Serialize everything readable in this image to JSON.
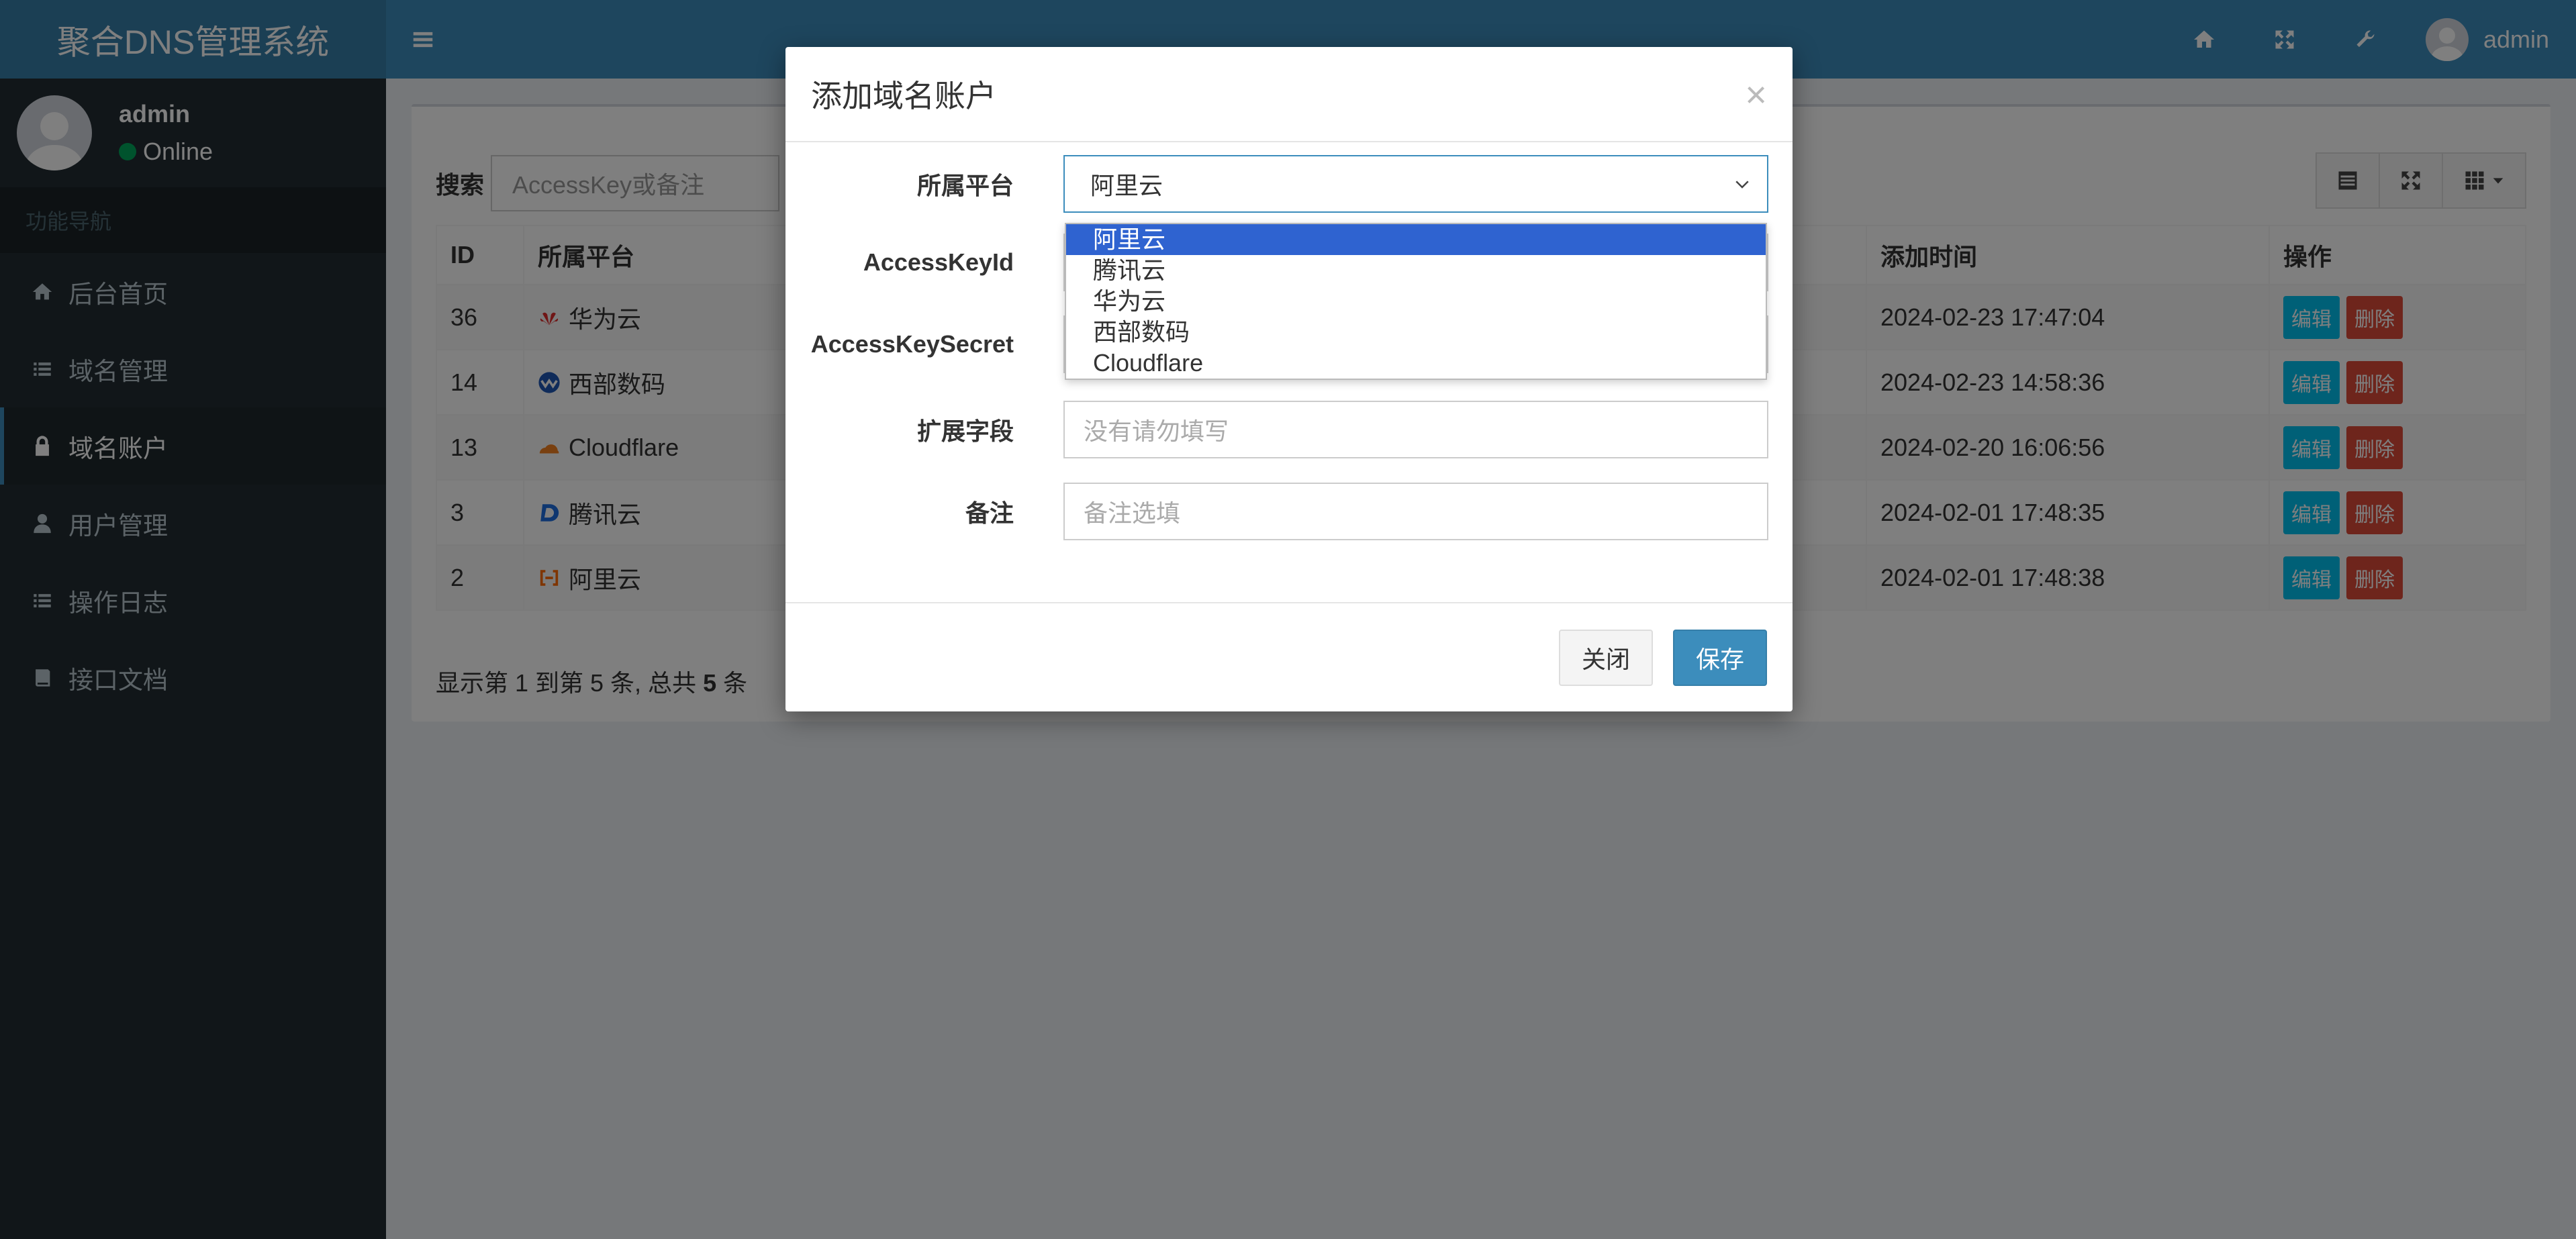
{
  "app": {
    "title": "聚合DNS管理系统"
  },
  "user": {
    "name": "admin",
    "status": "Online"
  },
  "sidebar": {
    "header": "功能导航",
    "items": [
      {
        "label": "后台首页",
        "icon": "home-icon"
      },
      {
        "label": "域名管理",
        "icon": "list-icon"
      },
      {
        "label": "域名账户",
        "icon": "lock-icon",
        "active": true
      },
      {
        "label": "用户管理",
        "icon": "user-icon"
      },
      {
        "label": "操作日志",
        "icon": "list-icon"
      },
      {
        "label": "接口文档",
        "icon": "book-icon"
      }
    ]
  },
  "topbar": {
    "username": "admin"
  },
  "search": {
    "label": "搜索",
    "placeholder": "AccessKey或备注"
  },
  "table": {
    "headers": {
      "id": "ID",
      "platform": "所属平台",
      "added": "添加时间",
      "ops": "操作"
    },
    "edit_label": "编辑",
    "delete_label": "删除",
    "rows": [
      {
        "id": "36",
        "platform": "华为云",
        "icon": "huawei-icon",
        "added": "2024-02-23 17:47:04"
      },
      {
        "id": "14",
        "platform": "西部数码",
        "icon": "west-digital-icon",
        "added": "2024-02-23 14:58:36"
      },
      {
        "id": "13",
        "platform": "Cloudflare",
        "icon": "cloudflare-icon",
        "added": "2024-02-20 16:06:56"
      },
      {
        "id": "3",
        "platform": "腾讯云",
        "icon": "tencent-icon",
        "added": "2024-02-01 17:48:35"
      },
      {
        "id": "2",
        "platform": "阿里云",
        "icon": "aliyun-icon",
        "added": "2024-02-01 17:48:38"
      }
    ]
  },
  "pager": {
    "prefix": "显示第 1 到第 5 条, 总共 ",
    "total": "5",
    "suffix": " 条"
  },
  "modal": {
    "title": "添加域名账户",
    "close_glyph": "×",
    "fields": {
      "platform_label": "所属平台",
      "platform_value": "阿里云",
      "accesskeyid_label": "AccessKeyId",
      "accesskeysecret_label": "AccessKeySecret",
      "ext_label": "扩展字段",
      "ext_placeholder": "没有请勿填写",
      "remark_label": "备注",
      "remark_placeholder": "备注选填"
    },
    "options": [
      "阿里云",
      "腾讯云",
      "华为云",
      "西部数码",
      "Cloudflare"
    ],
    "close_button": "关闭",
    "save_button": "保存"
  }
}
